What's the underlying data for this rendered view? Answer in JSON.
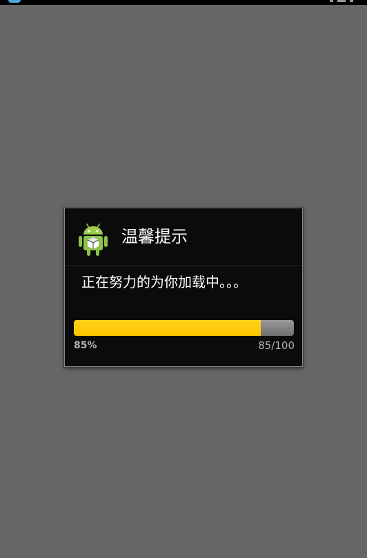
{
  "dialog": {
    "icon": "android-icon",
    "title": "温馨提示",
    "message": "正在努力的为你加载中。。。",
    "progress": {
      "value": 85,
      "max": 100,
      "percent_label": "85%",
      "count_label": "85/100",
      "fill_color": "#ffc400"
    }
  },
  "colors": {
    "screen_background": "#666666",
    "dialog_background": "#0b0b0b",
    "android_green": "#8bc34a"
  }
}
